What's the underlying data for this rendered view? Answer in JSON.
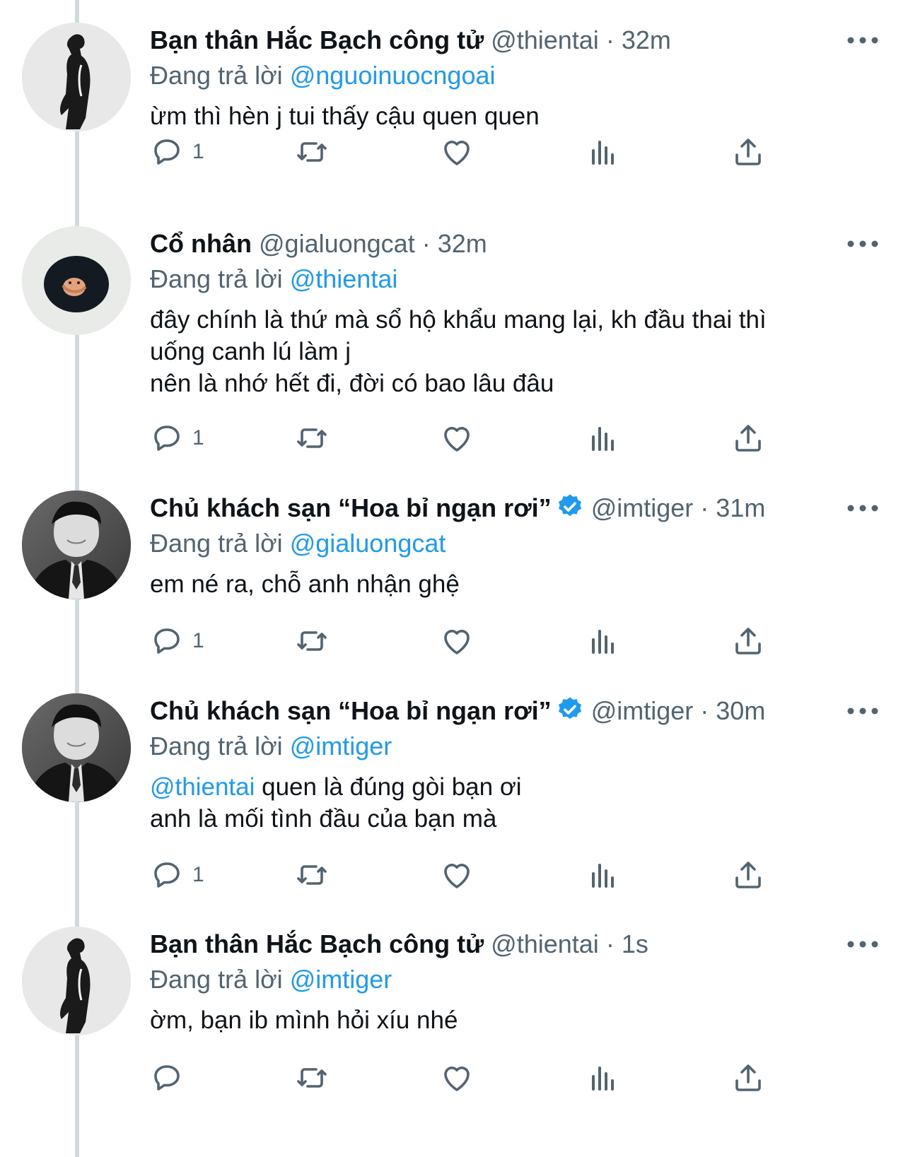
{
  "colors": {
    "accent": "#1d9bf0",
    "text_primary": "#0f1419",
    "text_secondary": "#536471",
    "thread_line": "#cfd9de"
  },
  "icons": {
    "reply": "reply-icon",
    "retweet": "retweet-icon",
    "like": "heart-icon",
    "views": "analytics-icon",
    "share": "share-icon",
    "more": "more-icon",
    "verified": "verified-badge-icon"
  },
  "tweets": [
    {
      "name": "Bạn thân Hắc Bạch công tử",
      "handle": "@thientai",
      "sep": "·",
      "time": "32m",
      "reply_prefix": "Đang trả lời",
      "reply_to": "@nguoinuocngoai",
      "lines": [
        "ừm thì hèn j tui thấy cậu quen quen"
      ],
      "reply_count": "1",
      "verified": false
    },
    {
      "name": "Cổ nhân",
      "handle": "@gialuongcat",
      "sep": "·",
      "time": "32m",
      "reply_prefix": "Đang trả lời",
      "reply_to": "@thientai",
      "lines": [
        "đây chính là thứ mà sổ hộ khẩu mang lại, kh đầu thai thì",
        "uống canh lú làm j",
        "nên là nhớ hết đi, đời có bao lâu đâu"
      ],
      "reply_count": "1",
      "verified": false
    },
    {
      "name": "Chủ khách sạn “Hoa bỉ ngạn rơi”",
      "handle": "@imtiger",
      "sep": "·",
      "time": "31m",
      "reply_prefix": "Đang trả lời",
      "reply_to": "@gialuongcat",
      "lines": [
        "em né ra, chỗ anh nhận ghệ"
      ],
      "reply_count": "1",
      "verified": true
    },
    {
      "name": "Chủ khách sạn “Hoa bỉ ngạn rơi”",
      "handle": "@imtiger",
      "sep": "·",
      "time": "30m",
      "reply_prefix": "Đang trả lời",
      "reply_to": "@imtiger",
      "lines_mention": "@thientai",
      "lines_first_rest": " quen là đúng gòi bạn ơi",
      "lines": [
        "anh là mối tình đầu của bạn mà"
      ],
      "reply_count": "1",
      "verified": true
    },
    {
      "name": "Bạn thân Hắc Bạch công tử",
      "handle": "@thientai",
      "sep": "·",
      "time": "1s",
      "reply_prefix": "Đang trả lời",
      "reply_to": "@imtiger",
      "lines": [
        "ờm, bạn ib mình hỏi xíu nhé"
      ],
      "reply_count": "",
      "verified": false
    }
  ]
}
